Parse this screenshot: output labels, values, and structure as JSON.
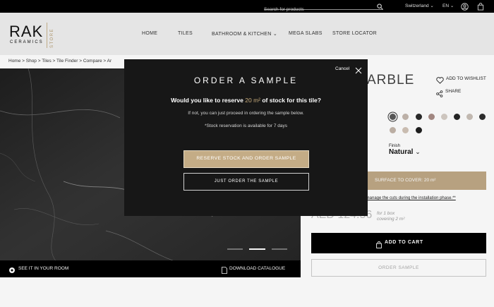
{
  "topbar": {
    "search_placeholder": "Search for products",
    "country": "Switzerland",
    "language": "EN"
  },
  "header": {
    "logo_main": "RAK",
    "logo_sub": "CERAMICS",
    "logo_store": "STORE",
    "nav": [
      "HOME",
      "TILES",
      "BATHROOM & KITCHEN",
      "MEGA SLABS",
      "STORE LOCATOR"
    ]
  },
  "breadcrumb": "Home > Shop > Tiles > Tile Finder > Compare > Ar",
  "photo": {
    "see_in_room": "SEE IT IN YOUR ROOM",
    "download": "DOWNLOAD CATALOGUE"
  },
  "product": {
    "title_fragment": "ARBLE",
    "wishlist": "ADD TO WISHLIST",
    "share": "SHARE",
    "swatch_colors": [
      "#5b5b5b",
      "#c4b8ae",
      "#2a2a2a",
      "#a88c86",
      "#d6cec6",
      "#262626",
      "#c9c0b8",
      "#2e2e2e",
      "#c3b6aa",
      "#d2c4b8",
      "#1f1f1f"
    ],
    "finish_label": "Finish",
    "finish_value": "Natural",
    "surface_label": "SURFACE TO COVER: 20 m²",
    "cuts_text": "to manage the cuts during the installation phase.**",
    "price": "AED 124.56",
    "price_for": "for 1 box",
    "price_covering": "covering 2 m²",
    "add_to_cart": "ADD TO CART",
    "order_sample": "ORDER SAMPLE"
  },
  "modal": {
    "title": "ORDER A SAMPLE",
    "cancel": "Cancel",
    "question_pre": "Would you like to reserve ",
    "question_amount": "20 m²",
    "question_post": " of stock for this tile?",
    "line1": "If not, you can just proceed in ordering the sample below.",
    "line2": "*Stock reservation is available for 7 days",
    "reserve_button": "RESERVE STOCK AND ORDER SAMPLE",
    "just_order_button": "JUST ORDER THE SAMPLE"
  }
}
